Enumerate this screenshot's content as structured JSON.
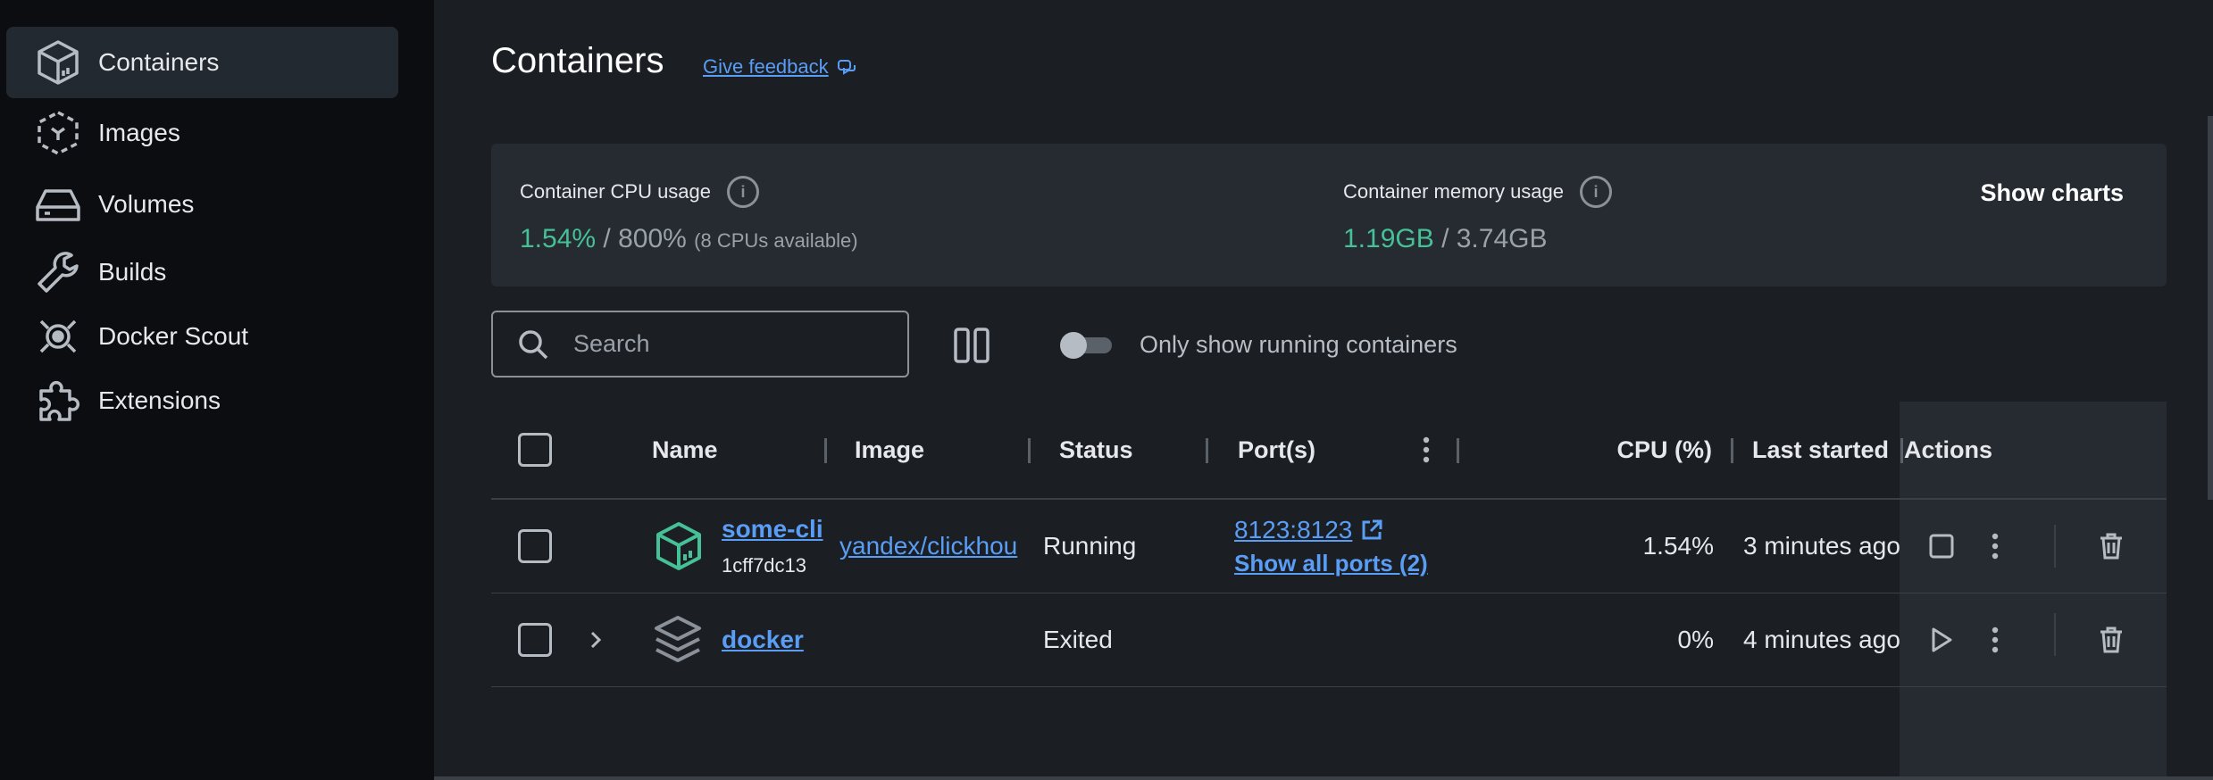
{
  "sidebar": {
    "items": [
      {
        "label": "Containers",
        "icon": "container-cube-icon",
        "active": true
      },
      {
        "label": "Images",
        "icon": "image-cube-icon"
      },
      {
        "label": "Volumes",
        "icon": "volume-disk-icon"
      },
      {
        "label": "Builds",
        "icon": "wrench-icon"
      },
      {
        "label": "Docker Scout",
        "icon": "docker-scout-icon"
      },
      {
        "label": "Extensions",
        "icon": "puzzle-icon"
      }
    ]
  },
  "header": {
    "title": "Containers",
    "feedback": "Give feedback"
  },
  "stats": {
    "cpu_label": "Container CPU usage",
    "cpu_used": "1.54%",
    "cpu_total": "/ 800%",
    "cpu_note": "(8 CPUs available)",
    "mem_label": "Container memory usage",
    "mem_used": "1.19GB",
    "mem_total": "/ 3.74GB",
    "show_charts": "Show charts"
  },
  "toolbar": {
    "search_placeholder": "Search",
    "toggle_label": "Only show running containers",
    "toggle_on": false
  },
  "table": {
    "headers": {
      "name": "Name",
      "image": "Image",
      "status": "Status",
      "ports": "Port(s)",
      "cpu": "CPU (%)",
      "last_started": "Last started",
      "actions": "Actions"
    },
    "rows": [
      {
        "name": "some-cli",
        "id": "1cff7dc13",
        "image": "yandex/clickhou",
        "status": "Running",
        "port": "8123:8123",
        "show_ports": "Show all ports (2)",
        "cpu": "1.54%",
        "last_started": "3 minutes ago"
      },
      {
        "name": "docker",
        "id": "",
        "image": "",
        "status": "Exited",
        "port": "",
        "show_ports": "",
        "cpu": "0%",
        "last_started": "4 minutes ago"
      }
    ]
  },
  "colors": {
    "accent_link": "#5a9df5",
    "green": "#46c096",
    "sidebar_bg": "#0c0d10",
    "main_bg": "#1b1f24"
  }
}
